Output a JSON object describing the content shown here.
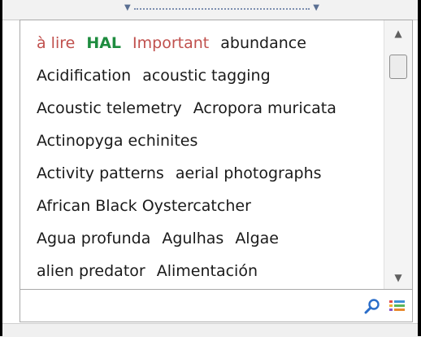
{
  "toolbar": {
    "grip_left_arrow": "▼",
    "grip_right_arrow": "▼"
  },
  "tags": {
    "rows": [
      [
        {
          "text": "à lire",
          "style": "red"
        },
        {
          "text": "HAL",
          "style": "green"
        },
        {
          "text": "Important",
          "style": "red"
        },
        {
          "text": "abundance",
          "style": "normal"
        }
      ],
      [
        {
          "text": "Acidification",
          "style": "normal"
        },
        {
          "text": "acoustic tagging",
          "style": "normal"
        }
      ],
      [
        {
          "text": "Acoustic telemetry",
          "style": "normal"
        },
        {
          "text": "Acropora muricata",
          "style": "normal"
        }
      ],
      [
        {
          "text": "Actinopyga echinites",
          "style": "normal"
        }
      ],
      [
        {
          "text": "Activity patterns",
          "style": "normal"
        },
        {
          "text": "aerial photographs",
          "style": "normal"
        }
      ],
      [
        {
          "text": "African Black Oystercatcher",
          "style": "normal"
        }
      ],
      [
        {
          "text": "Agua profunda",
          "style": "normal"
        },
        {
          "text": "Agulhas",
          "style": "normal"
        },
        {
          "text": "Algae",
          "style": "normal"
        }
      ],
      [
        {
          "text": "alien predator",
          "style": "normal"
        },
        {
          "text": "Alimentación",
          "style": "normal"
        }
      ]
    ]
  },
  "scrollbar": {
    "up_arrow": "▲",
    "down_arrow": "▼"
  },
  "search": {
    "value": "",
    "placeholder": ""
  },
  "icons": {
    "search": "search-icon",
    "filter": "filter-icon"
  }
}
